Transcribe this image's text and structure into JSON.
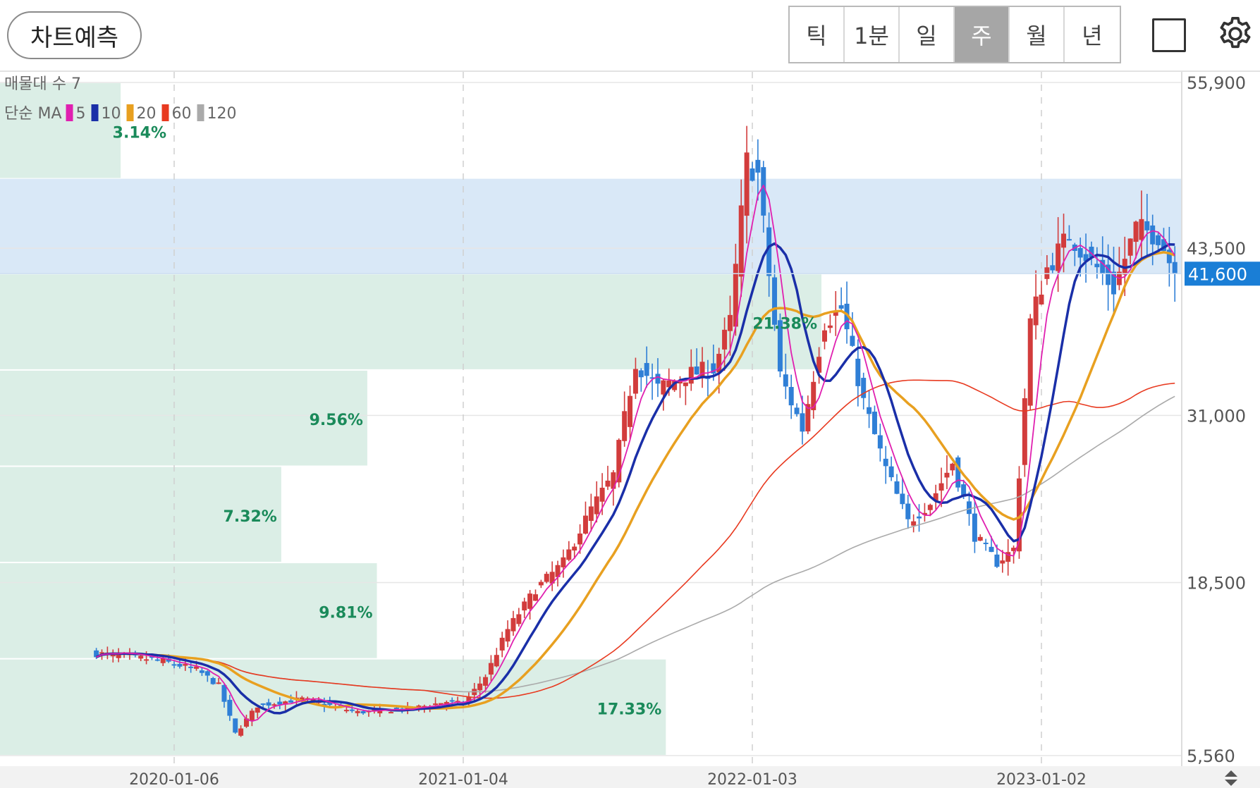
{
  "toolbar": {
    "predict_label": "차트예측",
    "periods": [
      "틱",
      "1분",
      "일",
      "주",
      "월",
      "년"
    ],
    "active_period": "주",
    "square_icon": "square-icon",
    "settings_icon": "gear-icon"
  },
  "legend": {
    "volume_profile_label": "매물대 수 7",
    "ma_label": "단순 MA",
    "ma_periods": [
      {
        "period": "5",
        "color": "#e020b0"
      },
      {
        "period": "10",
        "color": "#1a2fa8"
      },
      {
        "period": "20",
        "color": "#e8a020"
      },
      {
        "period": "60",
        "color": "#e83a20"
      },
      {
        "period": "120",
        "color": "#aaaaaa"
      }
    ]
  },
  "chart_data": {
    "type": "candlestick",
    "interval": "weekly",
    "y_ticks": [
      "55,900",
      "43,500",
      "31,000",
      "18,500",
      "5,560"
    ],
    "y_tick_values": [
      55900,
      43500,
      31000,
      18500,
      5560
    ],
    "ylim": [
      5560,
      55900
    ],
    "x_ticks": [
      "2020-01-06",
      "2021-01-04",
      "2022-01-03",
      "2023-01-02"
    ],
    "current_price": 41600,
    "current_price_label": "41,600",
    "current_price_color": "#1a7ed6",
    "up_color": "#d23c3c",
    "down_color": "#2f7fd6",
    "volume_profile": {
      "zones": [
        {
          "from": 48700,
          "to": 55900,
          "percent": 3.14,
          "label": "3.14%"
        },
        {
          "from": 41600,
          "to": 48700,
          "percent": 0,
          "label": "",
          "highlight": true
        },
        {
          "from": 34400,
          "to": 41600,
          "percent": 21.38,
          "label": "21.38%"
        },
        {
          "from": 27200,
          "to": 34400,
          "percent": 9.56,
          "label": "9.56%"
        },
        {
          "from": 20000,
          "to": 27200,
          "percent": 7.32,
          "label": "7.32%"
        },
        {
          "from": 12800,
          "to": 20000,
          "percent": 9.81,
          "label": "9.81%"
        },
        {
          "from": 5560,
          "to": 12800,
          "percent": 17.33,
          "label": "17.33%"
        }
      ],
      "highlight_color": "#d9e8f7",
      "zone_color": "#dbeee6",
      "label_color": "#1a8a5a"
    },
    "close_path": [
      {
        "date": "2019-09-30",
        "close": 13200
      },
      {
        "date": "2019-11-04",
        "close": 13000
      },
      {
        "date": "2019-12-16",
        "close": 12700
      },
      {
        "date": "2020-02-03",
        "close": 12000
      },
      {
        "date": "2020-03-02",
        "close": 10800
      },
      {
        "date": "2020-03-23",
        "close": 7200
      },
      {
        "date": "2020-04-20",
        "close": 9300
      },
      {
        "date": "2020-06-15",
        "close": 9800
      },
      {
        "date": "2020-08-24",
        "close": 8800
      },
      {
        "date": "2020-11-02",
        "close": 9100
      },
      {
        "date": "2020-12-14",
        "close": 9600
      },
      {
        "date": "2021-01-04",
        "close": 9400
      },
      {
        "date": "2021-02-01",
        "close": 11500
      },
      {
        "date": "2021-03-01",
        "close": 15000
      },
      {
        "date": "2021-04-05",
        "close": 18000
      },
      {
        "date": "2021-05-10",
        "close": 20000
      },
      {
        "date": "2021-06-14",
        "close": 24000
      },
      {
        "date": "2021-07-12",
        "close": 26500
      },
      {
        "date": "2021-08-09",
        "close": 35000
      },
      {
        "date": "2021-09-06",
        "close": 33000
      },
      {
        "date": "2021-10-11",
        "close": 34000
      },
      {
        "date": "2021-11-15",
        "close": 34500
      },
      {
        "date": "2021-12-06",
        "close": 38000
      },
      {
        "date": "2021-12-27",
        "close": 50000
      },
      {
        "date": "2022-01-10",
        "close": 49000
      },
      {
        "date": "2022-02-07",
        "close": 34000
      },
      {
        "date": "2022-03-07",
        "close": 30000
      },
      {
        "date": "2022-04-04",
        "close": 38000
      },
      {
        "date": "2022-04-25",
        "close": 39000
      },
      {
        "date": "2022-05-23",
        "close": 32000
      },
      {
        "date": "2022-06-20",
        "close": 27000
      },
      {
        "date": "2022-07-18",
        "close": 23000
      },
      {
        "date": "2022-08-15",
        "close": 24500
      },
      {
        "date": "2022-09-12",
        "close": 27500
      },
      {
        "date": "2022-10-10",
        "close": 22000
      },
      {
        "date": "2022-11-07",
        "close": 20000
      },
      {
        "date": "2022-11-28",
        "close": 21000
      },
      {
        "date": "2022-12-19",
        "close": 38000
      },
      {
        "date": "2023-01-09",
        "close": 42000
      },
      {
        "date": "2023-02-06",
        "close": 44500
      },
      {
        "date": "2023-03-06",
        "close": 42500
      },
      {
        "date": "2023-04-03",
        "close": 40500
      },
      {
        "date": "2023-05-01",
        "close": 45000
      },
      {
        "date": "2023-05-29",
        "close": 44500
      },
      {
        "date": "2023-06-19",
        "close": 41600
      }
    ]
  }
}
